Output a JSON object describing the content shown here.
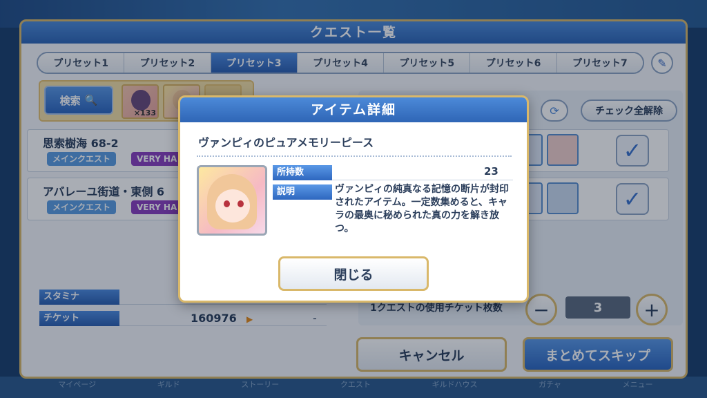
{
  "window": {
    "title": "クエスト一覧"
  },
  "tabs": [
    {
      "label": "プリセット1"
    },
    {
      "label": "プリセット2"
    },
    {
      "label": "プリセット3"
    },
    {
      "label": "プリセット4"
    },
    {
      "label": "プリセット5"
    },
    {
      "label": "プリセット6"
    },
    {
      "label": "プリセット7"
    }
  ],
  "active_tab": "プリセット3",
  "search": {
    "label": "検索",
    "slot_count": "×133"
  },
  "uncheck_all_label": "チェック全解除",
  "quests": [
    {
      "name": "思索樹海 68-2",
      "tag_main": "メインクエスト",
      "tag_difficulty": "VERY HA"
    },
    {
      "name": "アバレーユ街道・東側 6",
      "tag_main": "メインクエスト",
      "tag_difficulty": "VERY HA"
    }
  ],
  "stats": {
    "stamina_label": "スタミナ",
    "ticket_label": "チケット",
    "ticket_value": "160976",
    "ticket_after": "-"
  },
  "stepper": {
    "label": "1クエストの使用チケット枚数",
    "value": "3",
    "minus": "−",
    "plus": "+"
  },
  "buttons": {
    "cancel": "キャンセル",
    "skip_all": "まとめてスキップ"
  },
  "bottom_nav": [
    "マイページ",
    "ギルド",
    "ストーリー",
    "クエスト",
    "ギルドハウス",
    "ガチャ",
    "メニュー"
  ],
  "dialog": {
    "title": "アイテム詳細",
    "item_name": "ヴァンピィのピュアメモリーピース",
    "owned_label": "所持数",
    "owned_value": "23",
    "desc_label": "説明",
    "description": "ヴァンピィの純真なる記憶の断片が封印されたアイテム。一定数集めると、キャラの最奥に秘められた真の力を解き放つ。",
    "close_label": "閉じる"
  },
  "colors": {
    "accent": "#2f66b6",
    "gold_border": "#d9b86a",
    "difficulty_tag": "#8a3fbf"
  }
}
